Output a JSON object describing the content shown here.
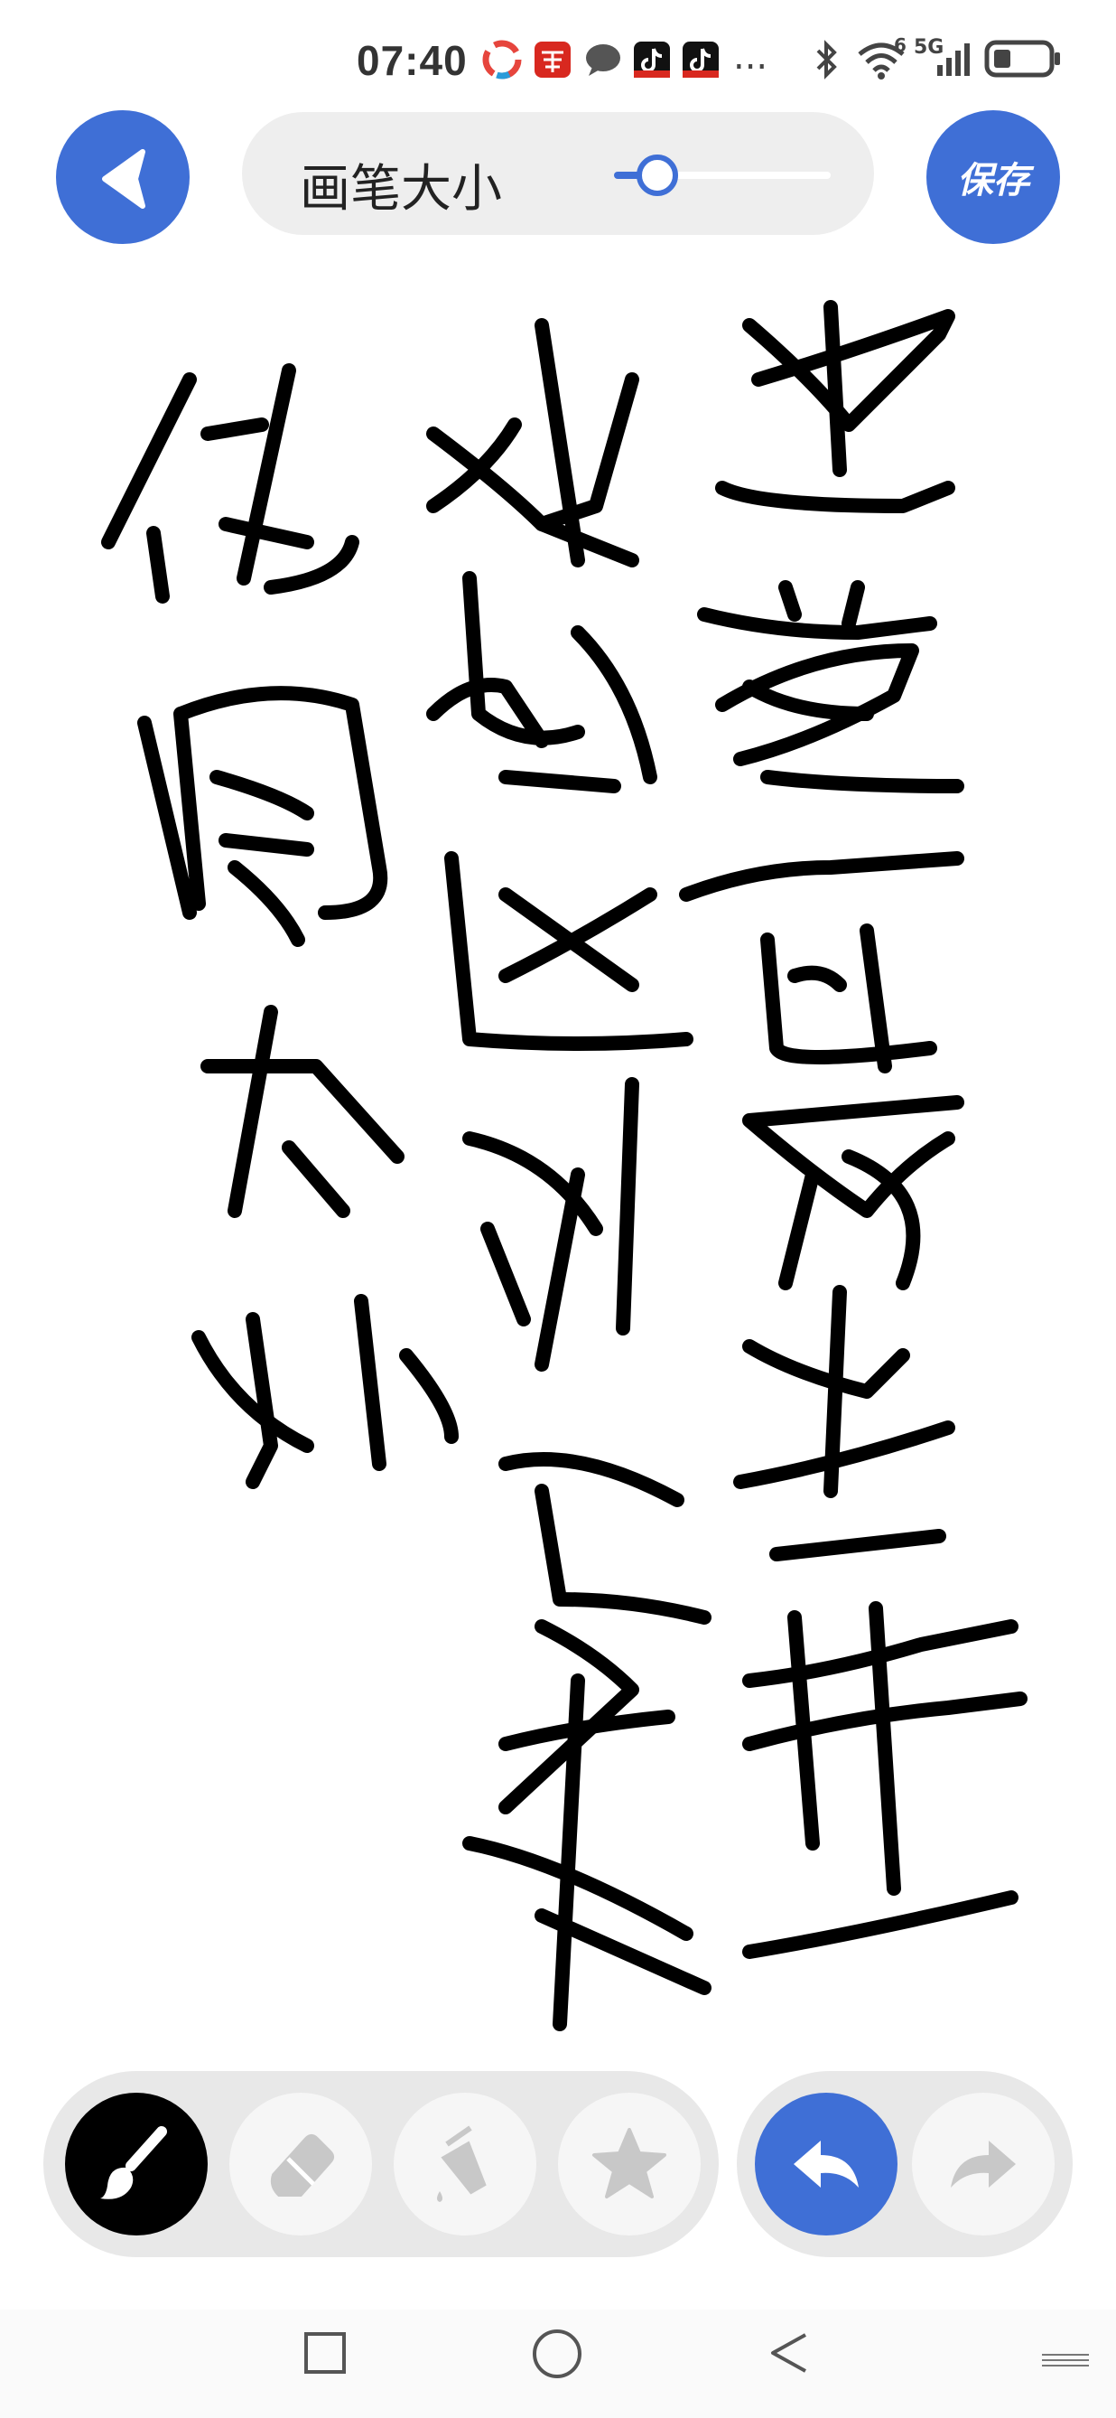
{
  "status_bar": {
    "time": "07:40",
    "app_icons": [
      "app-icon",
      "xuexi-icon",
      "chat-icon",
      "tiktok-icon",
      "tiktok-icon"
    ],
    "more": "...",
    "network_label": "5G",
    "signal_sup": "6"
  },
  "toolbar": {
    "brush_size_label": "画笔大小",
    "save_label": "保存",
    "brush_size_level": 0.2
  },
  "canvas": {
    "handwriting_text": "过堂也写到堂一 水的区别及其 你用大小"
  },
  "bottom_tools": {
    "items": [
      "brush-icon",
      "eraser-icon",
      "fill-bucket-icon",
      "star-icon",
      "undo-icon",
      "redo-icon"
    ],
    "active": "brush-icon"
  },
  "colors": {
    "accent": "#3f6fd6",
    "panel": "#eeeeee",
    "ink": "#000000"
  }
}
